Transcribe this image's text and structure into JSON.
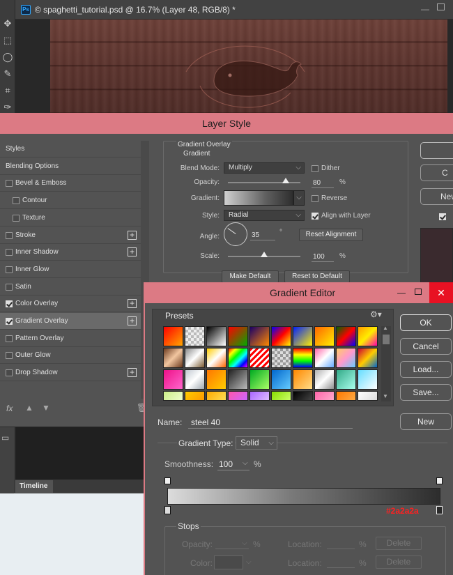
{
  "document": {
    "ps_badge": "Ps",
    "title": "© spaghetti_tutorial.psd @ 16.7% (Layer 48, RGB/8) *",
    "minimize": "—"
  },
  "layer_style": {
    "title": "Layer Style",
    "styles": [
      {
        "label": "Styles",
        "checkbox": false,
        "checked": false,
        "plus": false,
        "indent": 0
      },
      {
        "label": "Blending Options",
        "checkbox": false,
        "checked": false,
        "plus": false,
        "indent": 0
      },
      {
        "label": "Bevel & Emboss",
        "checkbox": true,
        "checked": false,
        "plus": false,
        "indent": 0
      },
      {
        "label": "Contour",
        "checkbox": true,
        "checked": false,
        "plus": false,
        "indent": 1
      },
      {
        "label": "Texture",
        "checkbox": true,
        "checked": false,
        "plus": false,
        "indent": 1
      },
      {
        "label": "Stroke",
        "checkbox": true,
        "checked": false,
        "plus": true,
        "indent": 0
      },
      {
        "label": "Inner Shadow",
        "checkbox": true,
        "checked": false,
        "plus": true,
        "indent": 0
      },
      {
        "label": "Inner Glow",
        "checkbox": true,
        "checked": false,
        "plus": false,
        "indent": 0
      },
      {
        "label": "Satin",
        "checkbox": true,
        "checked": false,
        "plus": false,
        "indent": 0
      },
      {
        "label": "Color Overlay",
        "checkbox": true,
        "checked": true,
        "plus": true,
        "indent": 0
      },
      {
        "label": "Gradient Overlay",
        "checkbox": true,
        "checked": true,
        "plus": true,
        "indent": 0,
        "selected": true
      },
      {
        "label": "Pattern Overlay",
        "checkbox": true,
        "checked": false,
        "plus": false,
        "indent": 0
      },
      {
        "label": "Outer Glow",
        "checkbox": true,
        "checked": false,
        "plus": false,
        "indent": 0
      },
      {
        "label": "Drop Shadow",
        "checkbox": true,
        "checked": false,
        "plus": true,
        "indent": 0
      }
    ],
    "fx_label": "fx",
    "gradient_overlay": {
      "group_title": "Gradient Overlay",
      "sub_title": "Gradient",
      "blend_mode_label": "Blend Mode:",
      "blend_mode": "Multiply",
      "dither_label": "Dither",
      "dither": false,
      "opacity_label": "Opacity:",
      "opacity": "80",
      "percent": "%",
      "gradient_label": "Gradient:",
      "reverse_label": "Reverse",
      "reverse": false,
      "style_label": "Style:",
      "style": "Radial",
      "align_label": "Align with Layer",
      "align": true,
      "angle_label": "Angle:",
      "angle": "35",
      "degree": "°",
      "reset_alignment": "Reset Alignment",
      "scale_label": "Scale:",
      "scale": "100",
      "make_default": "Make Default",
      "reset_default": "Reset to Default",
      "opacity_fraction": 0.8,
      "scale_fraction": 0.5
    },
    "right_buttons": [
      "C",
      "New"
    ]
  },
  "timeline": {
    "tab": "Timeline"
  },
  "gradient_editor": {
    "title": "Gradient Editor",
    "presets_label": "Presets",
    "name_label": "Name:",
    "name_value": "steel 40",
    "buttons": {
      "ok": "OK",
      "cancel": "Cancel",
      "load": "Load...",
      "save": "Save...",
      "new": "New"
    },
    "gradient_type_label": "Gradient Type:",
    "gradient_type": "Solid",
    "smoothness_label": "Smoothness:",
    "smoothness": "100",
    "percent": "%",
    "color_annotation": "#2a2a2a",
    "stops_label": "Stops",
    "opacity_label": "Opacity:",
    "color_label": "Color:",
    "location_label": "Location:",
    "delete_label": "Delete",
    "colors": {
      "accent": "#dc7a84",
      "annotation": "#ff2020"
    }
  }
}
